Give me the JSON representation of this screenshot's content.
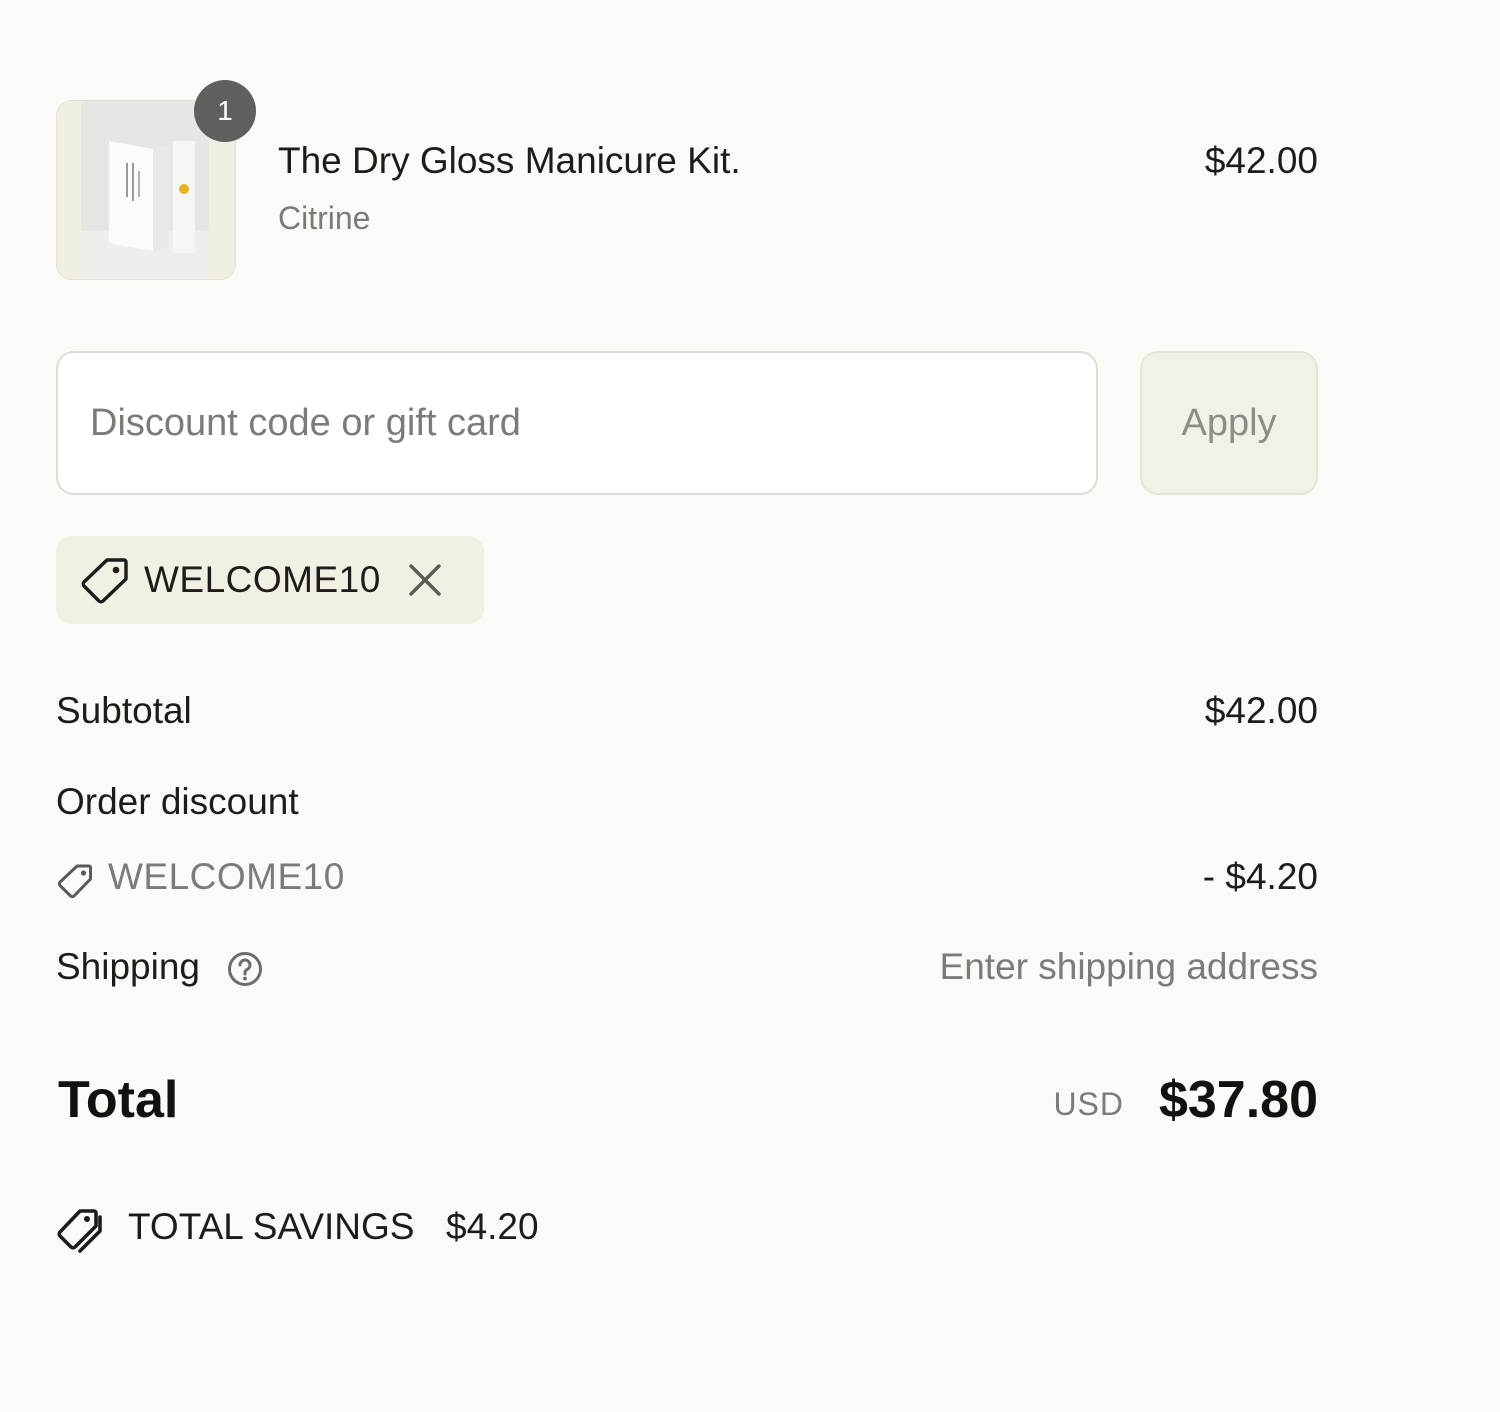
{
  "product": {
    "quantity": "1",
    "title": "The Dry Gloss Manicure Kit.",
    "variant": "Citrine",
    "price": "$42.00",
    "image_icon": "product-thumbnail"
  },
  "discount": {
    "placeholder": "Discount code or gift card",
    "value": "",
    "apply_label": "Apply",
    "applied_code": "WELCOME10"
  },
  "summary": {
    "subtotal_label": "Subtotal",
    "subtotal_value": "$42.00",
    "order_discount_label": "Order discount",
    "discount_code": "WELCOME10",
    "discount_value": "- $4.20",
    "shipping_label": "Shipping",
    "shipping_value": "Enter shipping address",
    "total_label": "Total",
    "currency": "USD",
    "total_value": "$37.80",
    "savings_label": "TOTAL SAVINGS",
    "savings_value": "$4.20"
  },
  "colors": {
    "background": "#fbfaf6",
    "chip_background": "#f1f0e3",
    "badge": "#5f5f5c",
    "muted_text": "#7b7b78",
    "text": "#1c1c1c"
  },
  "icons": {
    "tag": "tag-icon",
    "remove": "close-icon",
    "help": "question-circle-icon",
    "savings": "double-tag-icon"
  }
}
